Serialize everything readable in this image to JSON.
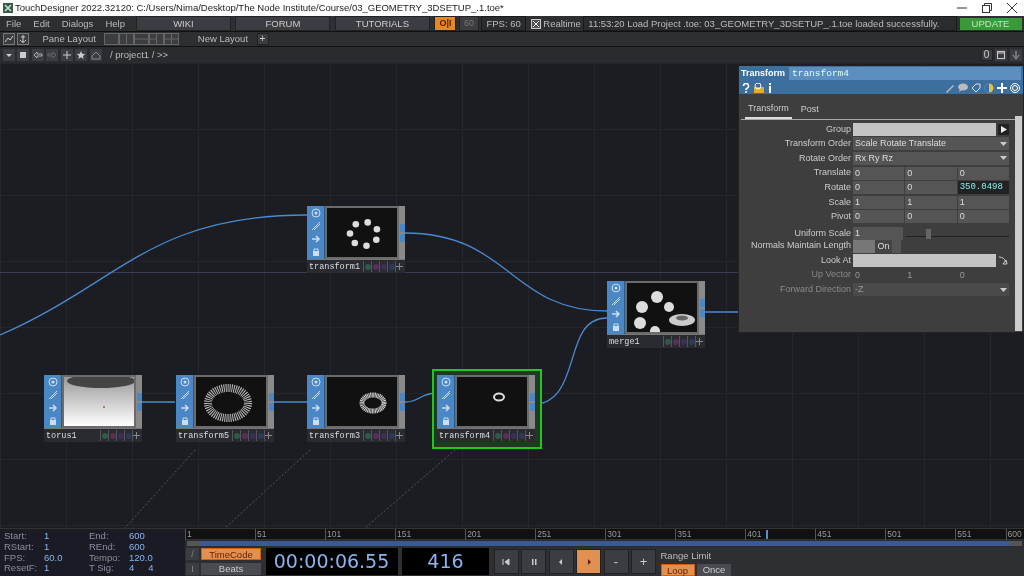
{
  "window": {
    "title": "TouchDesigner 2022.32120: C:/Users/Nima/Desktop/The Node Institute/Course/03_GEOMETRY_3DSETUP_.1.toe*"
  },
  "menu": [
    "File",
    "Edit",
    "Dialogs",
    "Help"
  ],
  "links": [
    "WIKI",
    "FORUM",
    "TUTORIALS"
  ],
  "perform": {
    "label": "O|I",
    "on": true
  },
  "fps_cap": "60",
  "fps": "FPS:  60",
  "realtime": {
    "label": "Realtime",
    "checked": true
  },
  "message": "11:53:20 Load Project .toe: 03_GEOMETRY_3DSETUP_.1.toe loaded successfully.",
  "update": "UPDATE",
  "layout_bar": {
    "pane_label": "Pane Layout",
    "new_label": "New Layout",
    "new_button": "+"
  },
  "path": "/ project1 / >>",
  "pane_count": "0",
  "nodes": [
    {
      "name": "transform1",
      "kind": "spheres",
      "selected": false
    },
    {
      "name": "merge1",
      "kind": "merged",
      "selected": false
    },
    {
      "name": "torus1",
      "kind": "surface",
      "selected": false
    },
    {
      "name": "transform5",
      "kind": "wireframe",
      "selected": false
    },
    {
      "name": "transform3",
      "kind": "torus",
      "selected": false
    },
    {
      "name": "transform4",
      "kind": "ring",
      "selected": true
    }
  ],
  "params": {
    "op_type": "Transform",
    "op_name": "transform4",
    "pages": [
      {
        "label": "Transform",
        "selected": true
      },
      {
        "label": "Post",
        "selected": false
      }
    ],
    "rows": [
      {
        "label": "Group",
        "kind": "text",
        "disabled": false
      },
      {
        "label": "Transform Order",
        "kind": "menu",
        "value": "Scale Rotate Translate",
        "disabled": false
      },
      {
        "label": "Rotate Order",
        "kind": "menu",
        "value": "Rx Ry Rz",
        "disabled": false
      },
      {
        "label": "Translate",
        "kind": "xyz",
        "disabled": false,
        "values": [
          {
            "text": "0",
            "changed": false
          },
          {
            "text": "0",
            "changed": false
          },
          {
            "text": "0",
            "changed": false
          }
        ]
      },
      {
        "label": "Rotate",
        "kind": "xyz",
        "disabled": false,
        "values": [
          {
            "text": "0",
            "changed": false
          },
          {
            "text": "0",
            "changed": false
          },
          {
            "text": "350.0498",
            "changed": true
          }
        ]
      },
      {
        "label": "Scale",
        "kind": "xyz",
        "disabled": false,
        "values": [
          {
            "text": "1",
            "changed": false
          },
          {
            "text": "1",
            "changed": false
          },
          {
            "text": "1",
            "changed": false
          }
        ]
      },
      {
        "label": "Pivot",
        "kind": "xyz",
        "disabled": false,
        "values": [
          {
            "text": "0",
            "changed": false
          },
          {
            "text": "0",
            "changed": false
          },
          {
            "text": "0",
            "changed": false
          }
        ]
      },
      {
        "label": "Uniform Scale",
        "kind": "slider",
        "value": "1",
        "level": 0.2,
        "disabled": false
      },
      {
        "label": "Normals Maintain Length",
        "kind": "toggle",
        "value": "On",
        "on": true,
        "disabled": false
      },
      {
        "label": "Look At",
        "kind": "op",
        "disabled": false
      },
      {
        "label": "Up Vector",
        "kind": "xyz",
        "disabled": true,
        "values": [
          {
            "text": "0",
            "changed": false
          },
          {
            "text": "1",
            "changed": false
          },
          {
            "text": "0",
            "changed": false
          }
        ]
      },
      {
        "label": "Forward Direction",
        "kind": "menu",
        "value": "-Z",
        "disabled": true
      }
    ]
  },
  "stats": [
    {
      "label": "Start:",
      "values": [
        "1"
      ]
    },
    {
      "label": "End:",
      "values": [
        "600"
      ]
    },
    {
      "label": "RStart:",
      "values": [
        "1"
      ]
    },
    {
      "label": "REnd:",
      "values": [
        "600"
      ]
    },
    {
      "label": "FPS:",
      "values": [
        "60.0"
      ]
    },
    {
      "label": "Tempo:",
      "values": [
        "120.0"
      ]
    },
    {
      "label": "ResetF:",
      "values": [
        "1"
      ]
    },
    {
      "label": "T Sig:",
      "values": [
        "4",
        "4"
      ]
    }
  ],
  "ruler": [
    "1",
    "51",
    "101",
    "151",
    "201",
    "251",
    "301",
    "351",
    "401",
    "451",
    "501",
    "551",
    "600"
  ],
  "playhead": {
    "level": 0.692
  },
  "side_tools": [
    "/",
    "I"
  ],
  "time_modes": [
    {
      "label": "TimeCode",
      "selected": true
    },
    {
      "label": "Beats",
      "selected": false
    }
  ],
  "timecode": "00:00:06.55",
  "frame": "416",
  "transport": [
    {
      "kind": "first",
      "selected": false
    },
    {
      "kind": "pause",
      "selected": false
    },
    {
      "kind": "back",
      "selected": false
    },
    {
      "kind": "play",
      "selected": true
    },
    {
      "kind": "text",
      "label": "-",
      "selected": false
    },
    {
      "kind": "text",
      "label": "+",
      "selected": false
    }
  ],
  "range_limit": {
    "label": "Range Limit",
    "options": [
      {
        "label": "Loop",
        "selected": true
      },
      {
        "label": "Once",
        "selected": false
      }
    ]
  }
}
